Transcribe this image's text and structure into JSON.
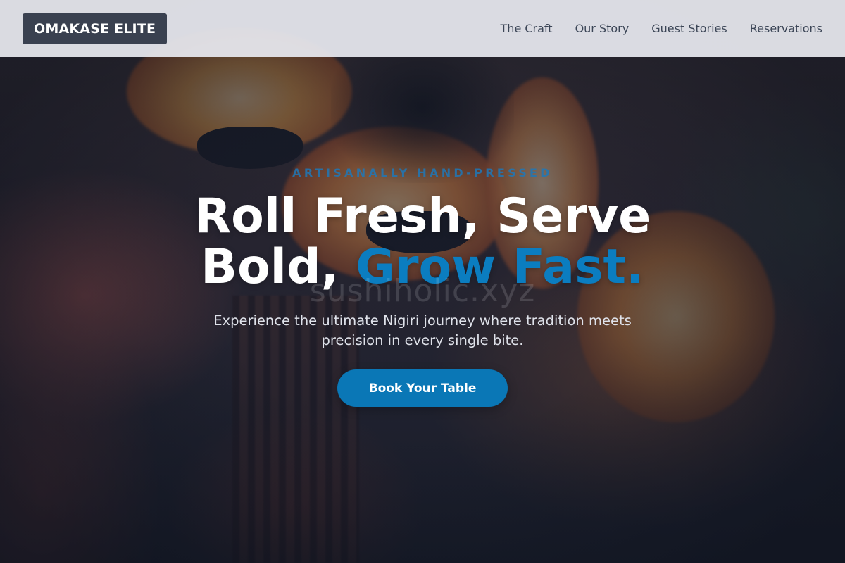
{
  "header": {
    "logo": "OMAKASE ELITE",
    "nav": [
      {
        "label": "The Craft"
      },
      {
        "label": "Our Story"
      },
      {
        "label": "Guest Stories"
      },
      {
        "label": "Reservations"
      }
    ]
  },
  "hero": {
    "eyebrow": "ARTISANALLY HAND-PRESSED",
    "headline_line1": "Roll Fresh, Serve",
    "headline_line2_plain": "Bold, ",
    "headline_line2_accent": "Grow Fast.",
    "watermark": "sushiholic.xyz",
    "subtitle": "Experience the ultimate Nigiri journey where tradition meets precision in every single bite.",
    "cta_label": "Book Your Table"
  },
  "colors": {
    "accent": "#0b7dc0",
    "header_bg": "#e8eaf0",
    "logo_bg": "#3a4150",
    "nav_text": "#3b4556"
  }
}
